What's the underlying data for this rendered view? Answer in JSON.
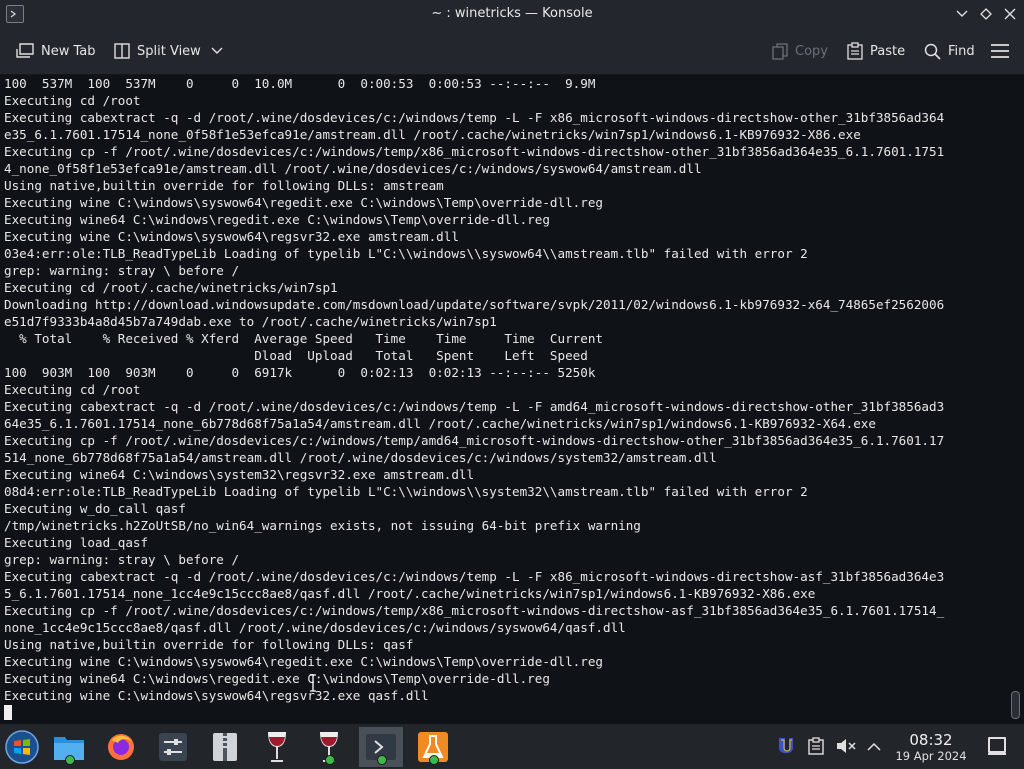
{
  "window": {
    "title": "~ : winetricks — Konsole",
    "icons": [
      "konsole-app-icon",
      "chevron-down-icon",
      "keep-above-icon",
      "close-icon"
    ]
  },
  "toolbar": {
    "new_tab": "New Tab",
    "split_view": "Split View",
    "copy": "Copy",
    "paste": "Paste",
    "find": "Find"
  },
  "terminal": {
    "lines": [
      "100  537M  100  537M    0     0  10.0M      0  0:00:53  0:00:53 --:--:--  9.9M",
      "Executing cd /root",
      "Executing cabextract -q -d /root/.wine/dosdevices/c:/windows/temp -L -F x86_microsoft-windows-directshow-other_31bf3856ad364",
      "e35_6.1.7601.17514_none_0f58f1e53efca91e/amstream.dll /root/.cache/winetricks/win7sp1/windows6.1-KB976932-X86.exe",
      "Executing cp -f /root/.wine/dosdevices/c:/windows/temp/x86_microsoft-windows-directshow-other_31bf3856ad364e35_6.1.7601.1751",
      "4_none_0f58f1e53efca91e/amstream.dll /root/.wine/dosdevices/c:/windows/syswow64/amstream.dll",
      "Using native,builtin override for following DLLs: amstream",
      "Executing wine C:\\windows\\syswow64\\regedit.exe C:\\windows\\Temp\\override-dll.reg",
      "Executing wine64 C:\\windows\\regedit.exe C:\\windows\\Temp\\override-dll.reg",
      "Executing wine C:\\windows\\syswow64\\regsvr32.exe amstream.dll",
      "03e4:err:ole:TLB_ReadTypeLib Loading of typelib L\"C:\\\\windows\\\\syswow64\\\\amstream.tlb\" failed with error 2",
      "grep: warning: stray \\ before /",
      "Executing cd /root/.cache/winetricks/win7sp1",
      "Downloading http://download.windowsupdate.com/msdownload/update/software/svpk/2011/02/windows6.1-kb976932-x64_74865ef2562006",
      "e51d7f9333b4a8d45b7a749dab.exe to /root/.cache/winetricks/win7sp1",
      "  % Total    % Received % Xferd  Average Speed   Time    Time     Time  Current",
      "                                 Dload  Upload   Total   Spent    Left  Speed",
      "100  903M  100  903M    0     0  6917k      0  0:02:13  0:02:13 --:--:-- 5250k",
      "Executing cd /root",
      "Executing cabextract -q -d /root/.wine/dosdevices/c:/windows/temp -L -F amd64_microsoft-windows-directshow-other_31bf3856ad3",
      "64e35_6.1.7601.17514_none_6b778d68f75a1a54/amstream.dll /root/.cache/winetricks/win7sp1/windows6.1-KB976932-X64.exe",
      "Executing cp -f /root/.wine/dosdevices/c:/windows/temp/amd64_microsoft-windows-directshow-other_31bf3856ad364e35_6.1.7601.17",
      "514_none_6b778d68f75a1a54/amstream.dll /root/.wine/dosdevices/c:/windows/system32/amstream.dll",
      "Executing wine64 C:\\windows\\system32\\regsvr32.exe amstream.dll",
      "08d4:err:ole:TLB_ReadTypeLib Loading of typelib L\"C:\\\\windows\\\\system32\\\\amstream.tlb\" failed with error 2",
      "Executing w_do_call qasf",
      "/tmp/winetricks.h2ZoUtSB/no_win64_warnings exists, not issuing 64-bit prefix warning",
      "Executing load_qasf",
      "grep: warning: stray \\ before /",
      "Executing cabextract -q -d /root/.wine/dosdevices/c:/windows/temp -L -F x86_microsoft-windows-directshow-asf_31bf3856ad364e3",
      "5_6.1.7601.17514_none_1cc4e9c15ccc8ae8/qasf.dll /root/.cache/winetricks/win7sp1/windows6.1-KB976932-X86.exe",
      "Executing cp -f /root/.wine/dosdevices/c:/windows/temp/x86_microsoft-windows-directshow-asf_31bf3856ad364e35_6.1.7601.17514_",
      "none_1cc4e9c15ccc8ae8/qasf.dll /root/.wine/dosdevices/c:/windows/syswow64/qasf.dll",
      "Using native,builtin override for following DLLs: qasf",
      "Executing wine C:\\windows\\syswow64\\regedit.exe C:\\windows\\Temp\\override-dll.reg",
      "Executing wine64 C:\\windows\\regedit.exe C:\\windows\\Temp\\override-dll.reg",
      "Executing wine C:\\windows\\syswow64\\regsvr32.exe qasf.dll"
    ]
  },
  "taskbar": {
    "apps": [
      "start-menu",
      "file-manager",
      "firefox",
      "system-settings",
      "archive-manager",
      "wine",
      "wine",
      "konsole",
      "lab-app"
    ],
    "tray_icons": [
      "wine-tray-icon",
      "clipboard-icon",
      "volume-muted-icon",
      "chevron-up-icon"
    ],
    "clock_time": "08:32",
    "clock_date": "19 Apr 2024"
  },
  "colors": {
    "terminal_bg": "#0f1216",
    "chrome_bg": "#23262c",
    "text": "#e8e8e8",
    "open_indicator": "#3dbb4a"
  }
}
